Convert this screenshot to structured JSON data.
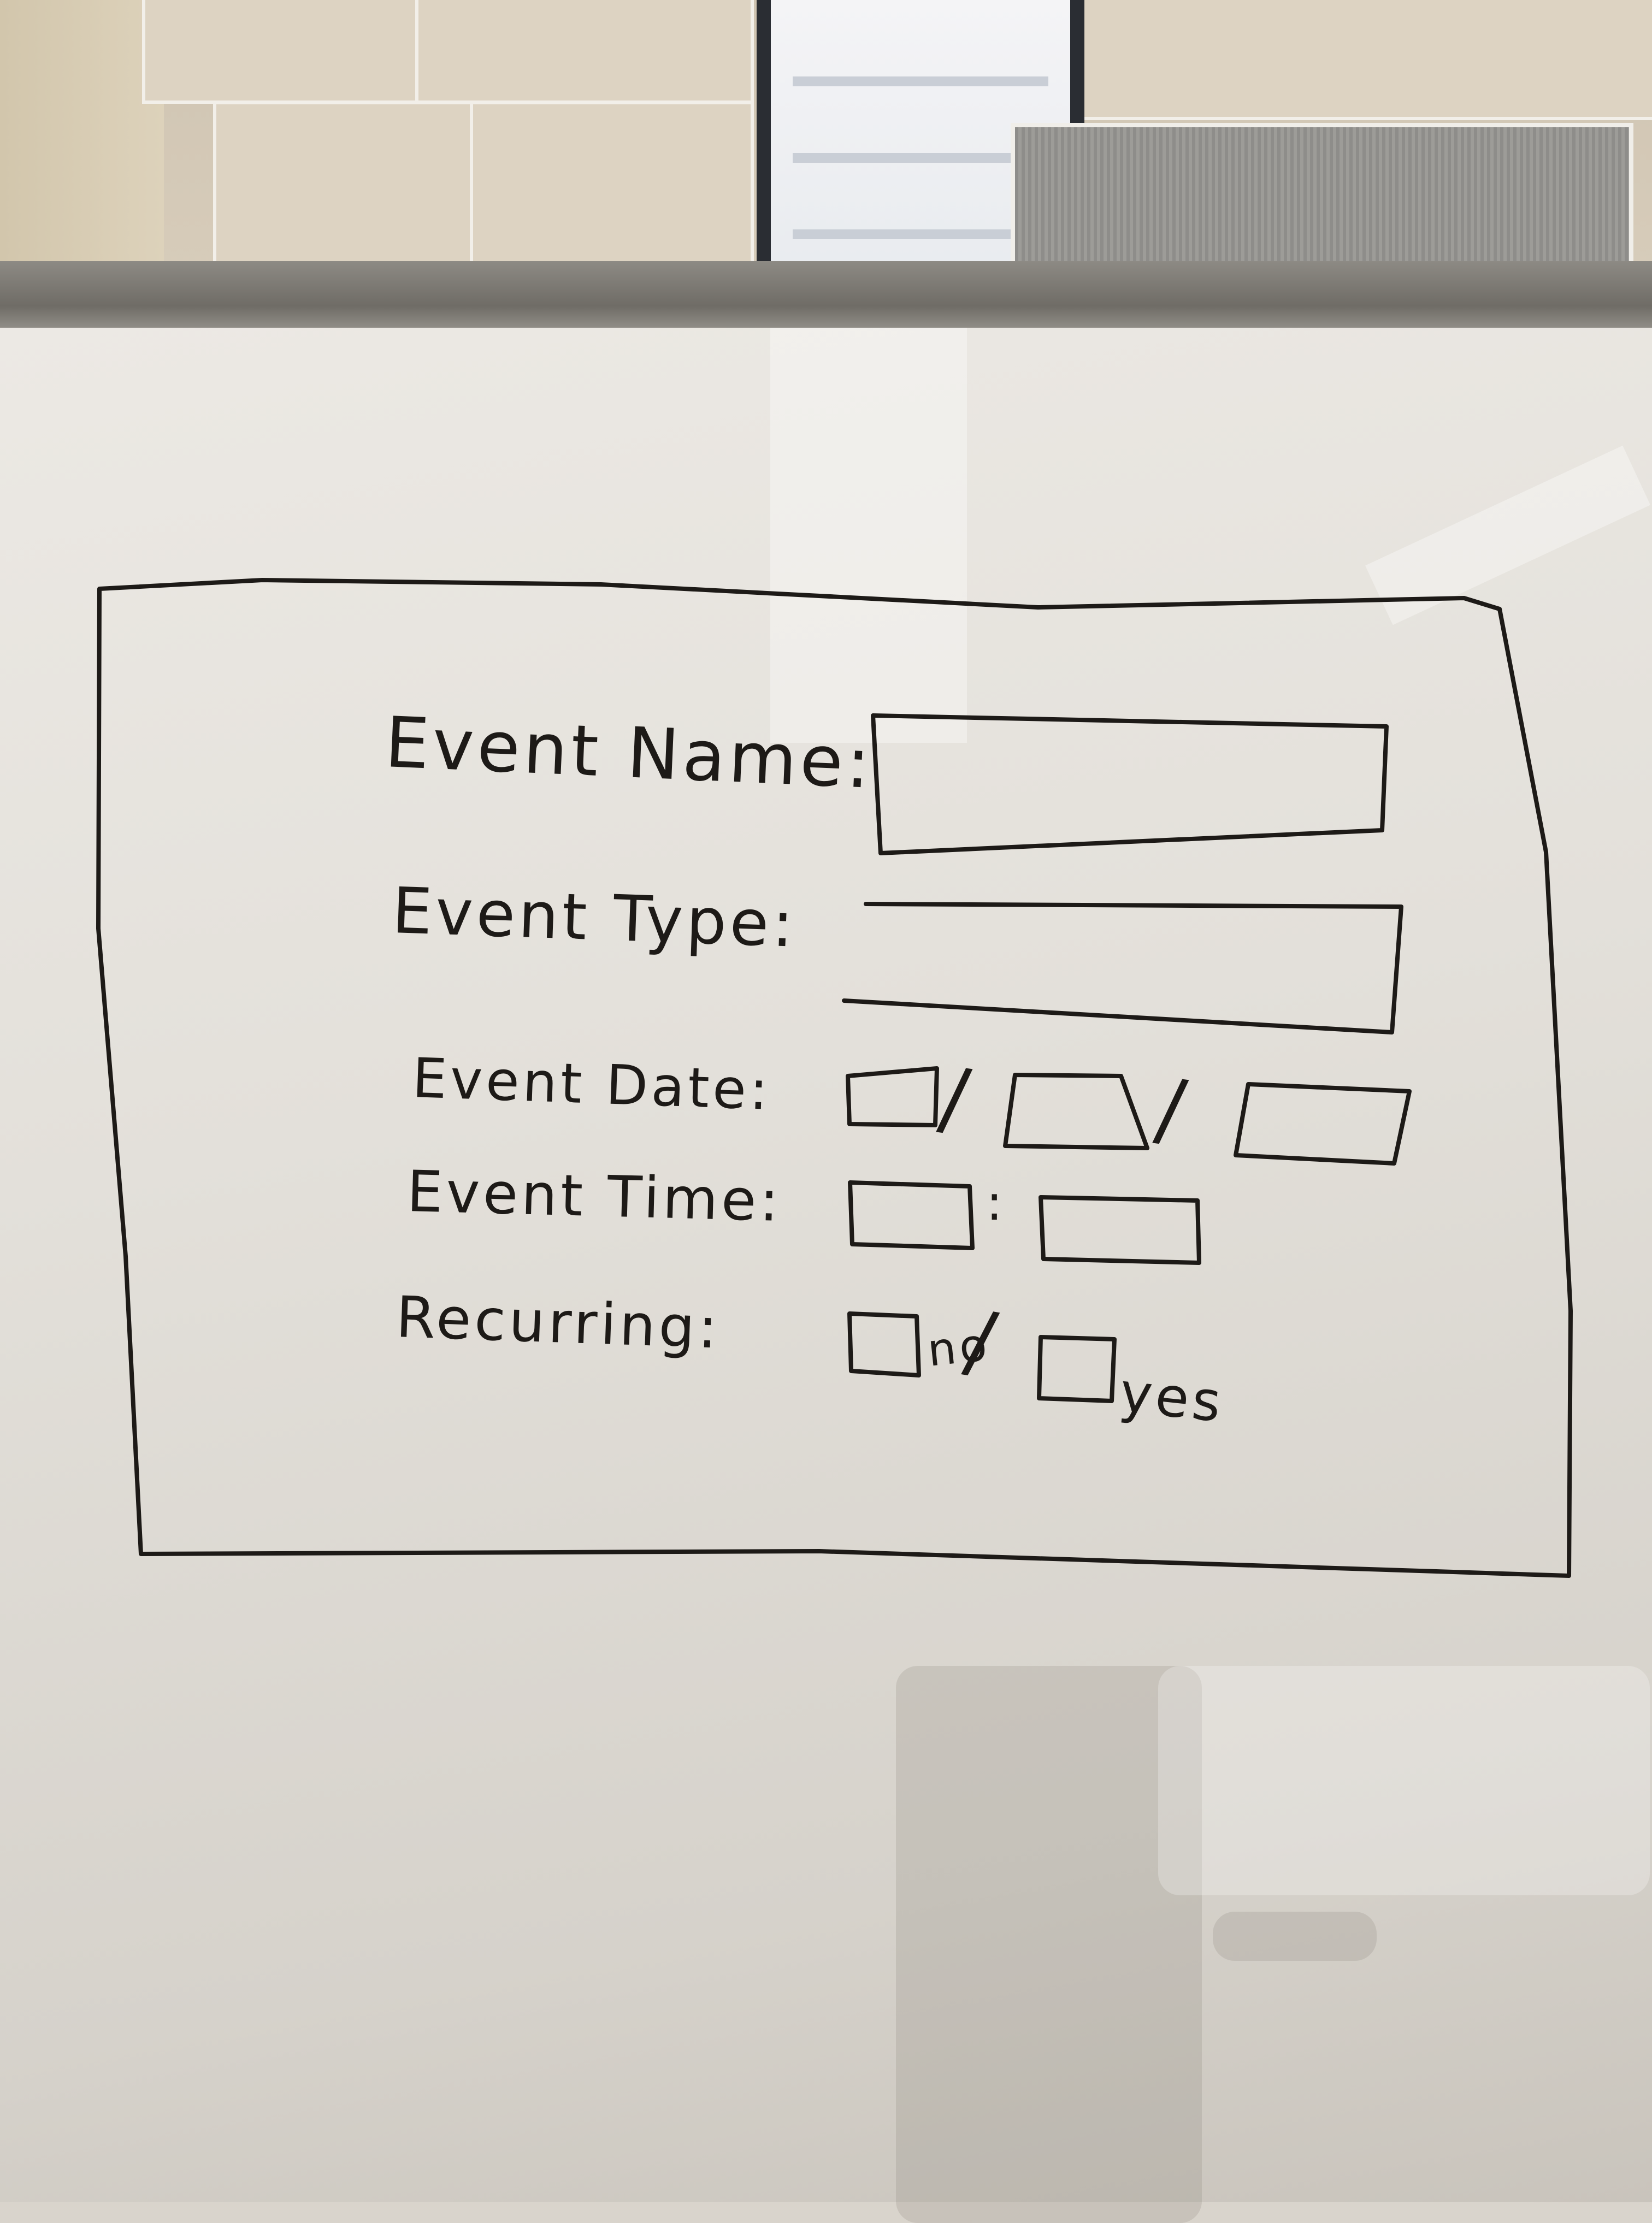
{
  "form": {
    "labels": {
      "event_name": "Event Name:",
      "event_type": "Event Type:",
      "event_date": "Event Date:",
      "event_time": "Event Time:",
      "recurring": "Recurring:"
    },
    "date_separator": "/",
    "time_separator": ":",
    "recurring_separator": "/",
    "recurring_options": {
      "no": "no",
      "yes": "yes"
    }
  },
  "colors": {
    "marker": "#1d1a17",
    "whiteboard": "#e6e3dd"
  }
}
